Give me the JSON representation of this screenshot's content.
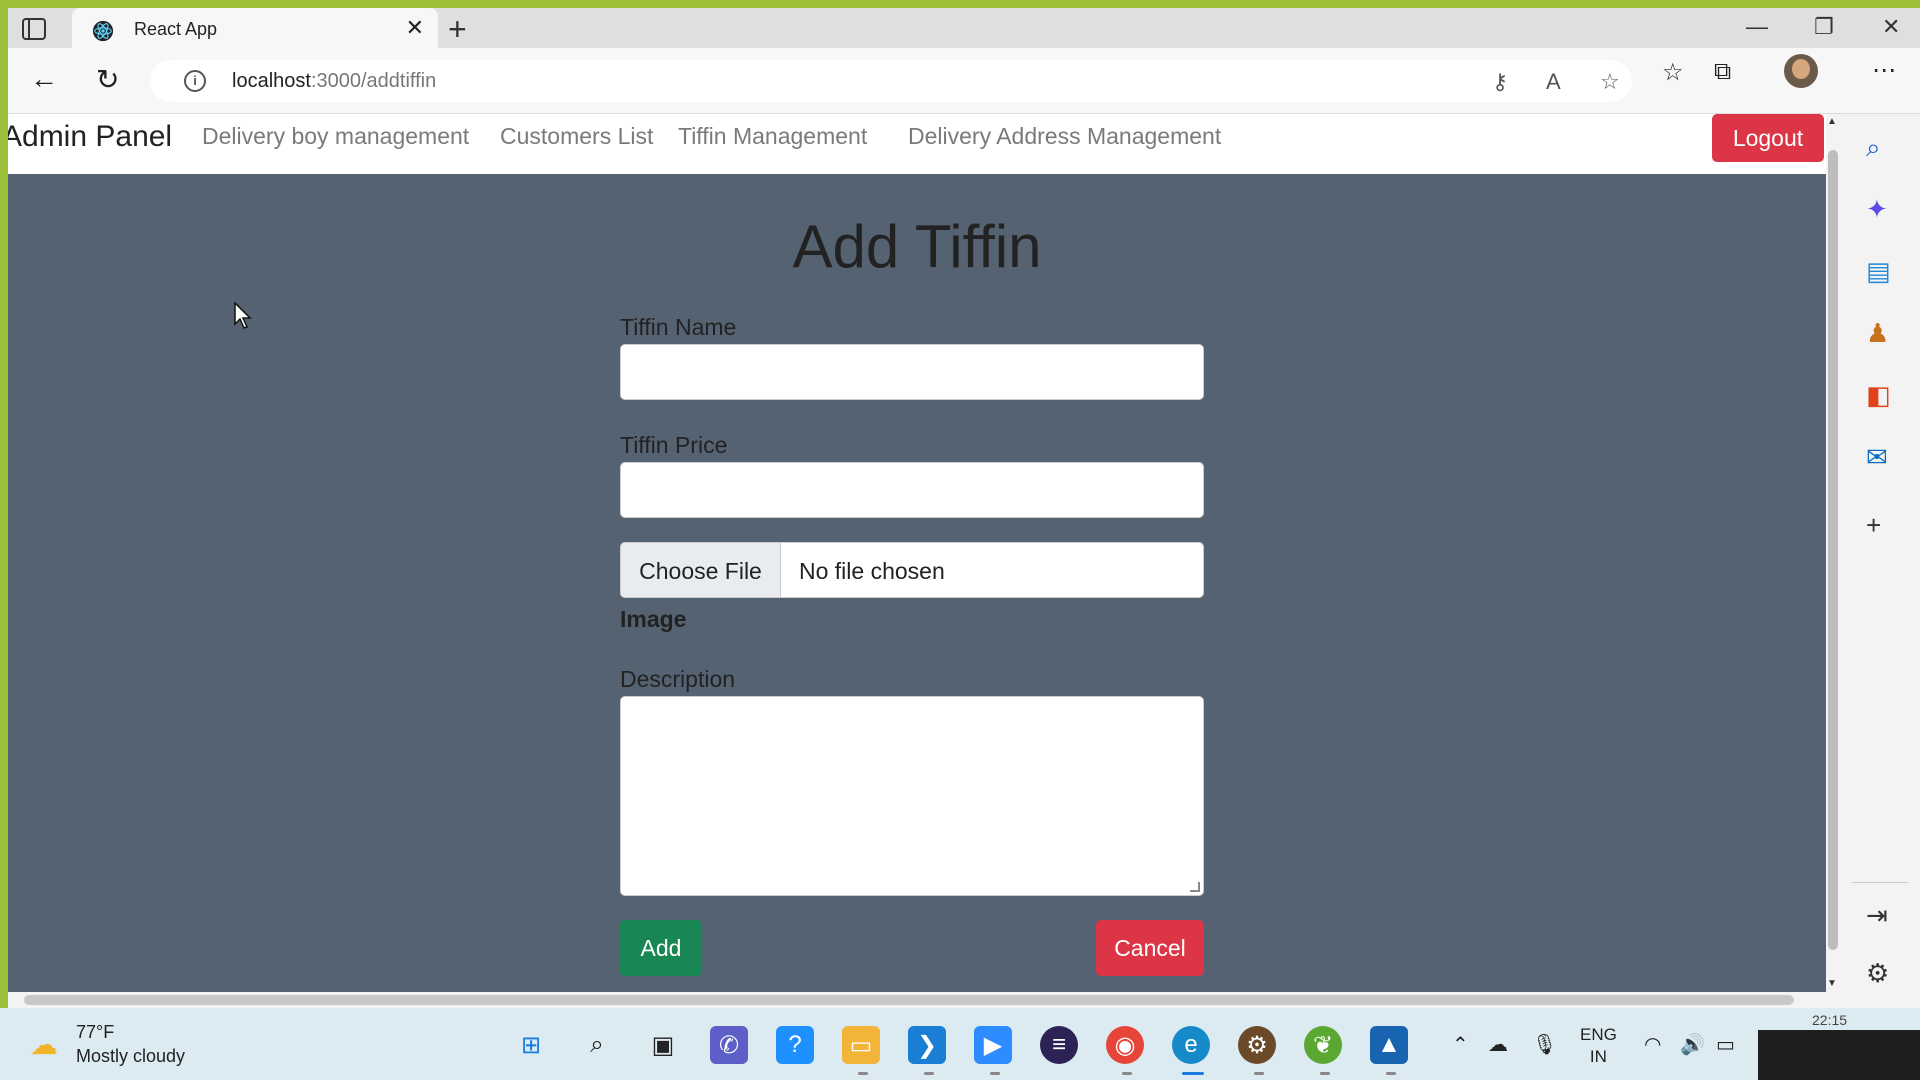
{
  "browser": {
    "tab_title": "React App",
    "url_host": "localhost",
    "url_path": ":3000/addtiffin"
  },
  "app": {
    "brand": "Admin Panel",
    "nav": [
      "Delivery boy management",
      "Customers List",
      "Tiffin Management",
      "Delivery Address Management"
    ],
    "logout_label": "Logout"
  },
  "form": {
    "title": "Add Tiffin",
    "name_label": "Tiffin Name",
    "name_value": "",
    "price_label": "Tiffin Price",
    "price_value": "",
    "file_button": "Choose File",
    "file_status": "No file chosen",
    "image_label": "Image",
    "description_label": "Description",
    "description_value": "",
    "add_label": "Add",
    "cancel_label": "Cancel"
  },
  "colors": {
    "page_bg": "#556272",
    "logout": "#dc3545",
    "add": "#198754",
    "cancel": "#dc3545"
  },
  "taskbar": {
    "weather_temp": "77°F",
    "weather_desc": "Mostly cloudy",
    "lang_1": "ENG",
    "lang_2": "IN",
    "clock_partial": "22:15"
  }
}
